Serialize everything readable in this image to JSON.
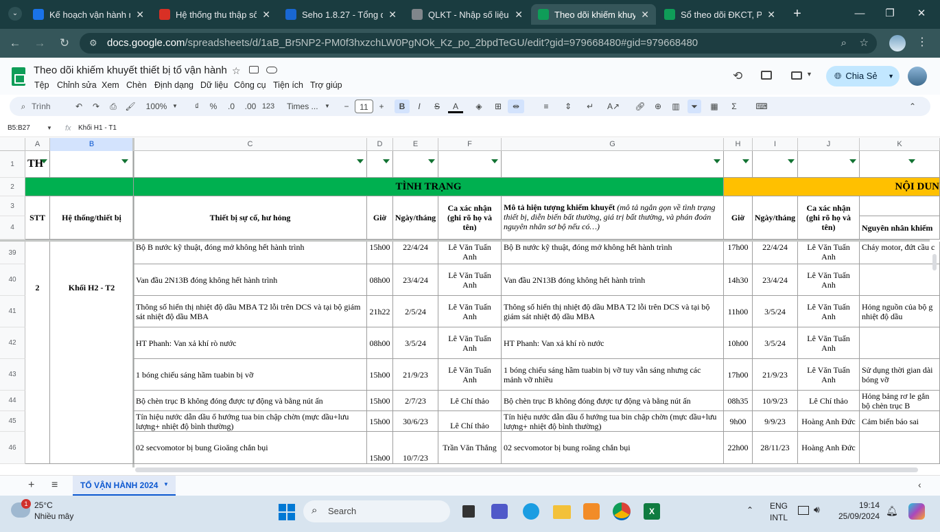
{
  "browser": {
    "tabs": [
      {
        "title": "Kế hoạch vận hành n",
        "icon_color": "#1a73e8",
        "active": false
      },
      {
        "title": "Hệ thống thu thập số",
        "icon_color": "#d93025",
        "active": false
      },
      {
        "title": "Seho 1.8.27 - Tổng q",
        "icon_color": "#1967d2",
        "active": false
      },
      {
        "title": "QLKT - Nhập số liệu v",
        "icon_color": "#80868b",
        "active": false
      },
      {
        "title": "Theo dõi khiếm khuyế",
        "icon_color": "#0f9d58",
        "active": true
      },
      {
        "title": "Sổ theo dõi ĐKCT, PC",
        "icon_color": "#0f9d58",
        "active": false
      }
    ],
    "url_host": "docs.google.com",
    "url_path": "/spreadsheets/d/1aB_Br5NP2-PM0f3hxzchLW0PgNOk_Kz_po_2bpdTeGU/edit?gid=979668480#gid=979668480"
  },
  "doc": {
    "title": "Theo dõi khiếm khuyết thiết bị tổ vận hành",
    "menu": [
      "Tệp",
      "Chỉnh sửa",
      "Xem",
      "Chèn",
      "Định dạng",
      "Dữ liệu",
      "Công cụ",
      "Tiện ích",
      "Trợ giúp"
    ],
    "share_label": "Chia Sẻ"
  },
  "toolbar": {
    "search_placeholder": "Trình đơn",
    "zoom": "100%",
    "currency": "₫",
    "percent": "%",
    "dec_less": ".0",
    "dec_more": ".00",
    "format_123": "123",
    "font": "Times ...",
    "font_size": "11",
    "bold": "B",
    "italic": "I",
    "strike": "S",
    "text_color": "A",
    "sigma": "Σ"
  },
  "formula": {
    "name_box": "B5:B27",
    "fx": "fx",
    "content": "Khối H1 - T1"
  },
  "grid": {
    "columns": [
      "A",
      "B",
      "C",
      "D",
      "E",
      "F",
      "G",
      "H",
      "I",
      "J",
      "K"
    ],
    "row1_a": "TH",
    "status_header": "TÌNH TRẠNG",
    "content_header": "NỘI DUN",
    "headers": {
      "stt": "STT",
      "system": "Hệ thống/thiết bị",
      "device": "Thiết bị sự cố, hư hỏng",
      "time": "Giờ",
      "date": "Ngày/tháng",
      "shift": "Ca xác nhận (ghi rõ họ và tên)",
      "desc_bold": "Mô tả hiện tượng khiếm khuyết",
      "desc_italic": " (mô tả ngắn gọn về tình trạng thiết bị, diễn biến bất thường, giá trị bất thường, và phán đoán nguyên nhân sơ bộ nếu có…)",
      "time2": "Giờ",
      "date2": "Ngày/tháng",
      "shift2": "Ca xác nhận (ghi rõ họ và tên)",
      "cause": "Nguyên nhân khiếm"
    },
    "group_stt": "2",
    "group_system": "Khối H2 - T2",
    "rows": [
      {
        "num": "39",
        "device": "Bộ B nước kỹ thuật, đóng mở không hết hành trình",
        "time": "15h00",
        "date": "22/4/24",
        "shift": "Lê Văn Tuấn Anh",
        "desc": "Bộ B nước kỹ thuật, đóng mở không hết hành trình",
        "time2": "17h00",
        "date2": "22/4/24",
        "shift2": "Lê Văn Tuấn Anh",
        "cause": "Cháy motor, đứt cầu c"
      },
      {
        "num": "40",
        "device": "Van đầu 2N13B đóng không hết hành trình",
        "time": "08h00",
        "date": "23/4/24",
        "shift": "Lê Văn Tuấn Anh",
        "desc": "Van đầu 2N13B đóng không hết hành trình",
        "time2": "14h30",
        "date2": "23/4/24",
        "shift2": "Lê Văn Tuấn Anh",
        "cause": ""
      },
      {
        "num": "41",
        "device": "Thông số hiển thị nhiệt độ dầu MBA T2 lỗi trên DCS và tại bộ giám sát nhiệt độ dầu MBA",
        "time": "21h22",
        "date": "2/5/24",
        "shift": "Lê Văn Tuấn Anh",
        "desc": "Thông số hiển thị nhiệt độ dầu MBA T2 lỗi trên DCS và tại bộ giám sát nhiệt độ dầu MBA",
        "time2": "11h00",
        "date2": "3/5/24",
        "shift2": "Lê Văn Tuấn Anh",
        "cause": "Hỏng nguồn của bộ g nhiệt độ dầu"
      },
      {
        "num": "42",
        "device": "HT Phanh: Van xả khí rò nước",
        "time": "08h00",
        "date": "3/5/24",
        "shift": "Lê Văn Tuấn Anh",
        "desc": "HT Phanh: Van xả khí rò nước",
        "time2": "10h00",
        "date2": "3/5/24",
        "shift2": "Lê Văn Tuấn Anh",
        "cause": ""
      },
      {
        "num": "43",
        "device": "1 bóng chiếu sáng hầm tuabin bị vỡ",
        "time": "15h00",
        "date": "21/9/23",
        "shift": "Lê Văn Tuấn Anh",
        "desc": "1 bóng chiếu sáng hầm tuabin bị vỡ tuy vẫn sáng nhưng các mảnh vỡ nhiều",
        "time2": "17h00",
        "date2": "21/9/23",
        "shift2": "Lê Văn Tuấn Anh",
        "cause": "Sử dụng thời gian dài bóng vỡ"
      },
      {
        "num": "44",
        "device": "Bộ chèn trục B không đóng được tự động và bằng nút ấn",
        "time": "15h00",
        "date": "2/7/23",
        "shift": "Lê Chí thảo",
        "desc": "Bộ chèn trục B không đóng được tự động và bằng nút ấn",
        "time2": "08h35",
        "date2": "10/9/23",
        "shift2": "Lê Chí thảo",
        "cause": "Hỏng bảng rơ le gắn bộ chèn trục B"
      },
      {
        "num": "45",
        "device": "Tín hiệu nước dẫn dầu ổ hướng tua bin chập chờn (mực dầu+lưu lượng+ nhiệt độ bình thường)",
        "time": "15h00",
        "date": "30/6/23",
        "shift": "Lê Chí thảo",
        "desc": "Tín hiệu nước dẫn dầu ổ hướng tua bin chập chờn (mực dầu+lưu lượng+ nhiệt độ bình thường)",
        "time2": "9h00",
        "date2": "9/9/23",
        "shift2": "Hoàng Anh Đức",
        "cause": "Cảm biến báo sai"
      },
      {
        "num": "46",
        "device": "02 secvomotor bị bung Gioăng chắn bụi",
        "time": "15h00",
        "date": "10/7/23",
        "shift": "Trần Văn Thắng",
        "desc": "02 secvomotor bị bung roăng chắn bụi",
        "time2": "22h00",
        "date2": "28/11/23",
        "shift2": "Hoàng Anh Đức",
        "cause": ""
      }
    ]
  },
  "sheet_tab": "TỔ VẬN HÀNH 2024",
  "taskbar": {
    "weather_temp": "25°C",
    "weather_desc": "Nhiều mây",
    "badge": "1",
    "search": "Search",
    "lang1": "ENG",
    "lang2": "INTL",
    "time": "19:14",
    "date": "25/09/2024"
  },
  "colors": {
    "tab_bg": "#1a3c40",
    "green_header": "#00b050",
    "orange_header": "#ffc000",
    "share": "#c2e7ff"
  }
}
